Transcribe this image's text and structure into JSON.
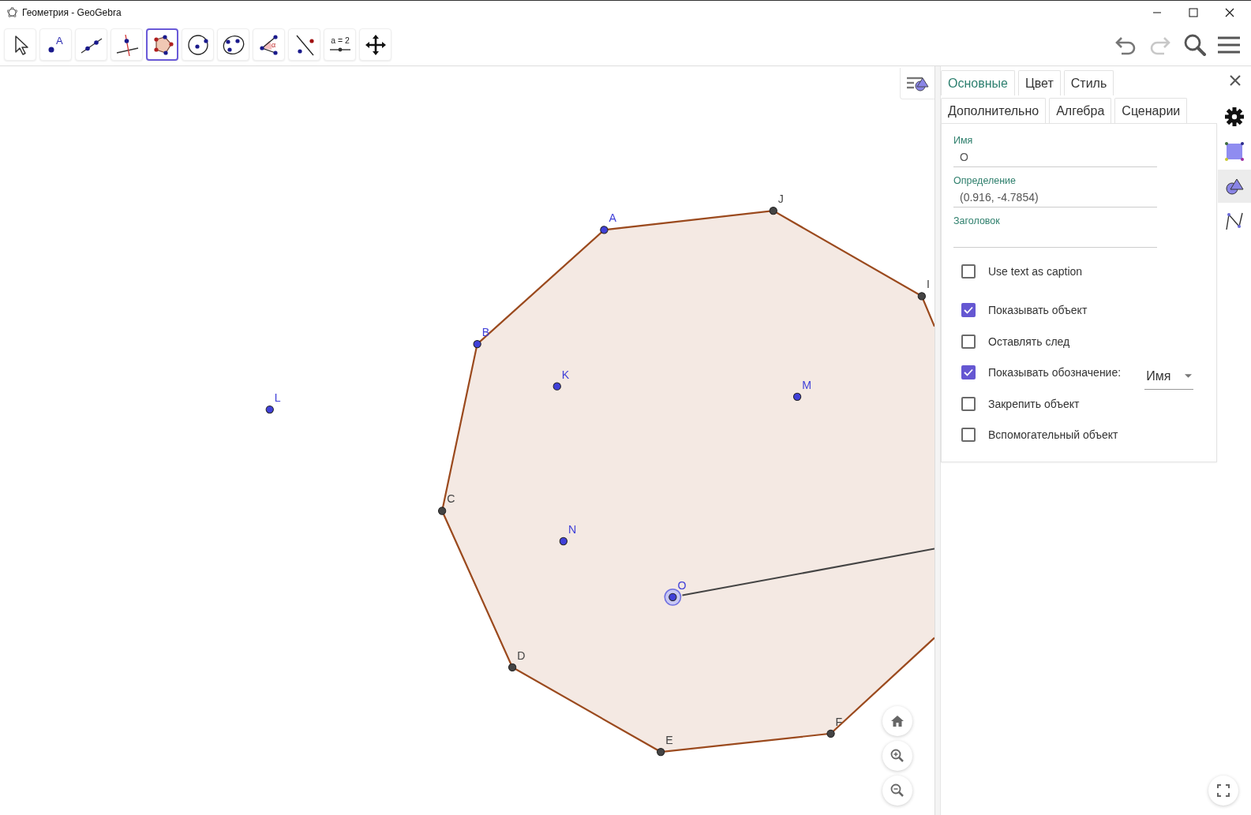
{
  "window": {
    "title": "Геометрия - GeoGebra"
  },
  "toolbar": {
    "tools": [
      {
        "kind": "move",
        "selected": false
      },
      {
        "kind": "point",
        "text": "A",
        "selected": false
      },
      {
        "kind": "line",
        "selected": false
      },
      {
        "kind": "perpendicular",
        "selected": false
      },
      {
        "kind": "polygon",
        "selected": true
      },
      {
        "kind": "circle",
        "selected": false
      },
      {
        "kind": "conic",
        "selected": false
      },
      {
        "kind": "angle",
        "text": "α",
        "selected": false
      },
      {
        "kind": "reflect",
        "selected": false
      },
      {
        "kind": "slider",
        "text": "a = 2",
        "selected": false
      },
      {
        "kind": "pan",
        "selected": false
      }
    ],
    "undo": {
      "disabled": false
    },
    "redo": {
      "disabled": true
    }
  },
  "canvas": {
    "points": [
      {
        "label": "A",
        "color": "#4040d8",
        "selected": false
      },
      {
        "label": "J",
        "color": "#444444",
        "selected": false
      },
      {
        "label": "I",
        "color": "#444444",
        "selected": false
      },
      {
        "label": "B",
        "color": "#4040d8",
        "selected": false
      },
      {
        "label": "K",
        "color": "#4040d8",
        "selected": false
      },
      {
        "label": "M",
        "color": "#4040d8",
        "selected": false
      },
      {
        "label": "L",
        "color": "#4040d8",
        "selected": false
      },
      {
        "label": "C",
        "color": "#444444",
        "selected": false
      },
      {
        "label": "N",
        "color": "#4040d8",
        "selected": false
      },
      {
        "label": "O",
        "color": "#4040d8",
        "selected": true
      },
      {
        "label": "D",
        "color": "#444444",
        "selected": false
      },
      {
        "label": "F",
        "color": "#444444",
        "selected": false
      },
      {
        "label": "E",
        "color": "#444444",
        "selected": false
      }
    ]
  },
  "properties": {
    "tab_rows": [
      [
        {
          "label": "Основные",
          "selected": true
        },
        {
          "label": "Цвет",
          "selected": false
        },
        {
          "label": "Стиль",
          "selected": false
        }
      ],
      [
        {
          "label": "Дополнительно",
          "selected": false
        },
        {
          "label": "Алгебра",
          "selected": false
        },
        {
          "label": "Сценарии",
          "selected": false
        }
      ]
    ],
    "fields": [
      {
        "label": "Имя",
        "value": "O"
      },
      {
        "label": "Определение",
        "value": "(0.916, -4.7854)"
      },
      {
        "label": "Заголовок"
      }
    ],
    "options": [
      {
        "label": "Use text as caption",
        "checked": false
      },
      {
        "label": "Показывать объект",
        "checked": true
      },
      {
        "label": "Оставлять след",
        "checked": false
      },
      {
        "label": "Показывать обозначение:",
        "checked": true,
        "dropdown": "Имя"
      },
      {
        "label": "Закрепить объект",
        "checked": false
      },
      {
        "label": "Вспомогательный объект",
        "checked": false
      }
    ],
    "side_tabs": [
      {
        "kind": "settings",
        "selected": false
      },
      {
        "kind": "graphics",
        "selected": false
      },
      {
        "kind": "geometry",
        "selected": true
      },
      {
        "kind": "curve",
        "selected": false
      }
    ]
  }
}
